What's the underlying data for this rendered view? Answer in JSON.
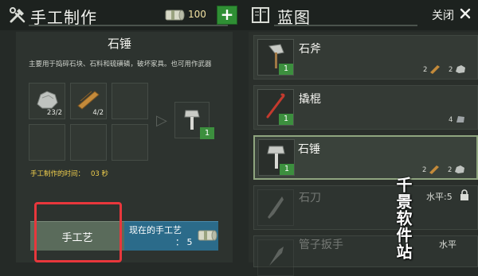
{
  "header": {
    "craft_title": "手工制作",
    "money_count": "100",
    "add_label": "+",
    "blueprint_title": "蓝图",
    "close_label": "关闭"
  },
  "craft": {
    "item_name": "石锤",
    "description": "主要用于捣碎石块、石料和硫磺磷，破坏家具。也可用作武器",
    "ingredients": [
      {
        "icon": "stone-icon",
        "qty": "23/2"
      },
      {
        "icon": "wood-plank-icon",
        "qty": "4/2"
      }
    ],
    "result_count": "1",
    "time_label": "手工制作的时间：",
    "time_value": "03 秒",
    "craft_button": "手工艺",
    "current_label": "现在的手工艺",
    "current_count": "：   5"
  },
  "blueprints": [
    {
      "name": "石斧",
      "level": "1",
      "req_wood": "2",
      "req_stone": "2",
      "icon": "stone-axe-icon",
      "state": "normal"
    },
    {
      "name": "撬棍",
      "level": "1",
      "req_metal": "4",
      "icon": "crowbar-icon",
      "state": "normal"
    },
    {
      "name": "石锤",
      "level": "1",
      "req_wood": "2",
      "req_stone": "2",
      "icon": "stone-hammer-icon",
      "state": "selected"
    },
    {
      "name": "石刀",
      "lock_text": "水平:5",
      "icon": "stone-knife-icon",
      "state": "locked"
    },
    {
      "name": "管子扳手",
      "lock_text": "水平",
      "icon": "pipe-wrench-icon",
      "state": "locked"
    }
  ],
  "watermark": "千景软件站",
  "colors": {
    "accent_green": "#3c8f3e",
    "highlight_red": "#e8373c",
    "craft_time_yellow": "#f0cf4d",
    "current_blue": "#2b6b8a"
  }
}
